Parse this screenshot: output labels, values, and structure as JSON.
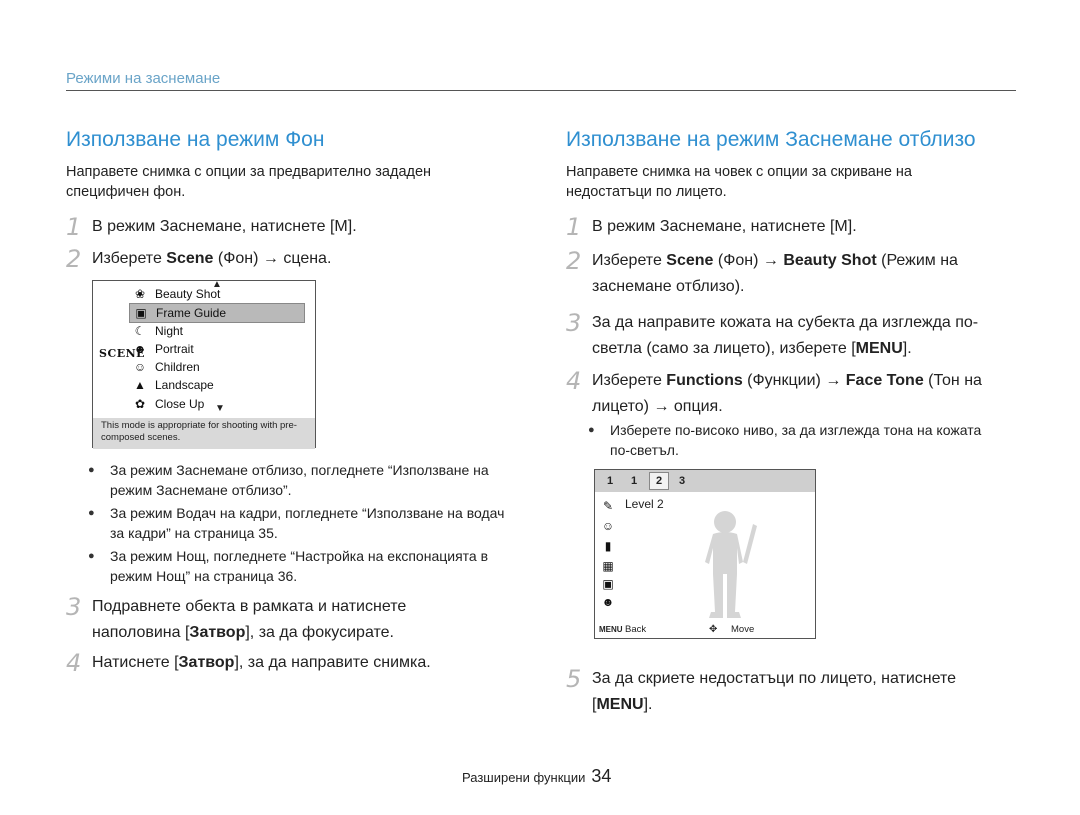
{
  "section_header": "Режими на заснемане",
  "left": {
    "title": "Използване на режим Фон",
    "intro": "Направете снимка с опции за предварително зададен специфичен фон.",
    "step1": {
      "num": "1",
      "text": "В режим Заснемане, натиснете [M]."
    },
    "step2": {
      "num": "2",
      "pre": "Изберете ",
      "bold": "Scene",
      "post": " (Фон) → сцена."
    },
    "screen": {
      "scene_label": "SCENE",
      "items": [
        {
          "label": "Beauty Shot",
          "icon": "beauty-icon",
          "glyph": "❀"
        },
        {
          "label": "Frame Guide",
          "icon": "frame-guide-icon",
          "glyph": "▣"
        },
        {
          "label": "Night",
          "icon": "night-icon",
          "glyph": "☾"
        },
        {
          "label": "Portrait",
          "icon": "portrait-icon",
          "glyph": "☻"
        },
        {
          "label": "Children",
          "icon": "children-icon",
          "glyph": "☺"
        },
        {
          "label": "Landscape",
          "icon": "landscape-icon",
          "glyph": "▲"
        },
        {
          "label": "Close Up",
          "icon": "closeup-icon",
          "glyph": "✿"
        }
      ],
      "selected": "Frame Guide",
      "note": "This mode is appropriate for shooting with pre-composed scenes."
    },
    "bullets": [
      "За режим Заснемане отблизо, погледнете “Използване на режим Заснемане отблизо”.",
      "За режим Водач на кадри, погледнете “Използване на водач за кадри” на страница 35.",
      "За режим Нощ, погледнете “Настройка на експонацията в режим Нощ” на страница 36."
    ],
    "step3": {
      "num": "3",
      "pre": "Подравнете обекта в рамката и натиснете наполовина [",
      "bold": "Затвор",
      "post": "], за да фокусирате."
    },
    "step4": {
      "num": "4",
      "pre": "Натиснете [",
      "bold": "Затвор",
      "post": "], за да направите снимка."
    }
  },
  "right": {
    "title": "Използване на режим Заснемане отблизо",
    "intro": "Направете снимка на човек с опции за скриване на недостатъци по лицето.",
    "step1": {
      "num": "1",
      "text": "В режим Заснемане, натиснете [M]."
    },
    "step2": {
      "num": "2",
      "pre": "Изберете ",
      "b1": "Scene",
      "mid": " (Фон) → ",
      "b2": "Beauty Shot",
      "post": " (Режим на заснемане отблизо)."
    },
    "step3": {
      "num": "3",
      "pre": "За да направите кожата на субекта да изглежда по-светла (само за лицето), изберете [",
      "bold": "MENU",
      "post": "]."
    },
    "step4": {
      "num": "4",
      "pre": "Изберете ",
      "b1": "Functions",
      "mid": " (Функции) → ",
      "b2": "Face Tone",
      "post": " (Тон на лицето) → опция."
    },
    "bullets": [
      "Изберете по-високо ниво, за да изглежда тона на кожата по-светъл."
    ],
    "screen": {
      "tabs": [
        "1",
        "1",
        "2",
        "3"
      ],
      "selected_tab_index": 2,
      "level_label": "Level 2",
      "menu_tag": "MENU",
      "back_label": "Back",
      "move_label": "Move"
    },
    "step5": {
      "num": "5",
      "pre": "За да скриете недостатъци по лицето, натиснете [",
      "bold": "MENU",
      "post": "]."
    }
  },
  "footer": {
    "label": "Разширени функции",
    "page": "34"
  }
}
